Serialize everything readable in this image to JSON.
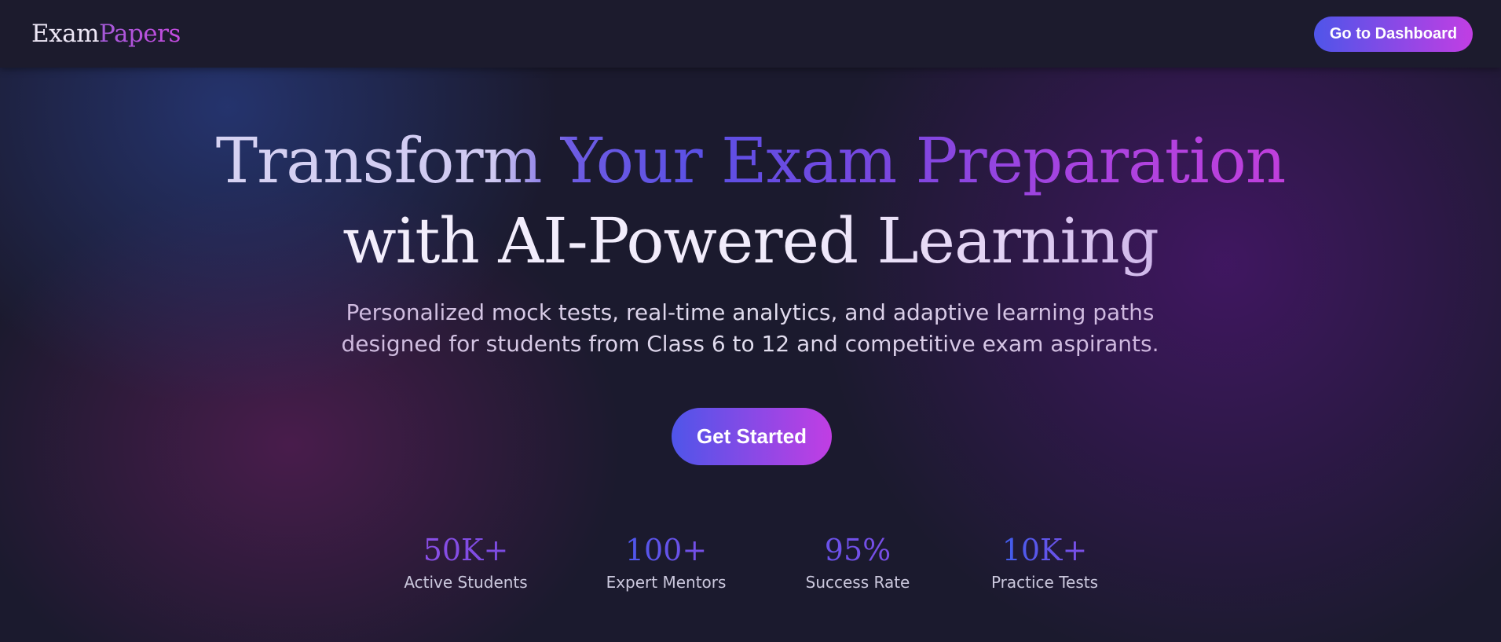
{
  "header": {
    "logo_part1": "Exam",
    "logo_part2": "Papers",
    "dashboard_button": "Go to Dashboard"
  },
  "hero": {
    "title_line1": "Transform Your Exam Preparation",
    "title_line2": "with AI-Powered Learning",
    "subtitle": "Personalized mock tests, real-time analytics, and adaptive learning paths designed for students from Class 6 to 12 and competitive exam aspirants.",
    "cta_button": "Get Started"
  },
  "stats": [
    {
      "value": "50K+",
      "label": "Active Students"
    },
    {
      "value": "100+",
      "label": "Expert Mentors"
    },
    {
      "value": "95%",
      "label": "Success Rate"
    },
    {
      "value": "10K+",
      "label": "Practice Tests"
    }
  ],
  "colors": {
    "background": "#1b1a2e",
    "header_background": "#1c1b2d",
    "accent_start": "#4f55e9",
    "accent_end": "#c13ee3"
  }
}
